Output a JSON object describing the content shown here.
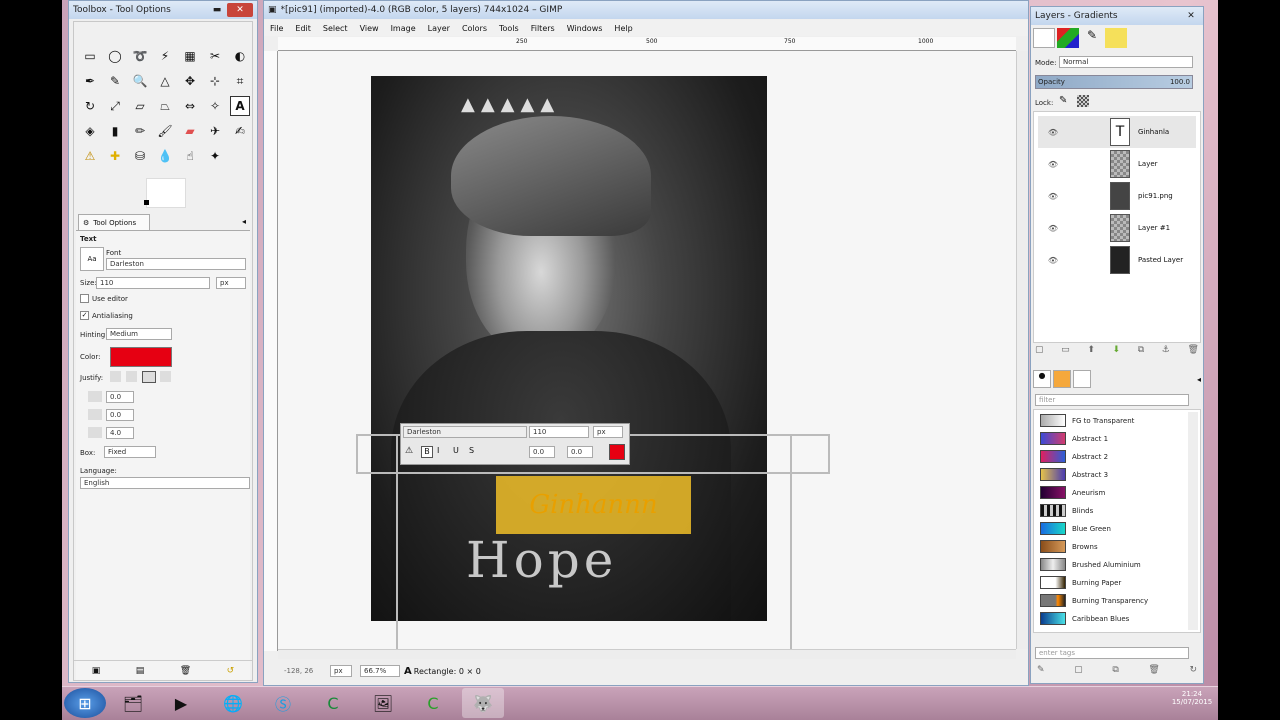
{
  "toolbox": {
    "title": "Toolbox - Tool Options",
    "tool_options_tab": "Tool Options",
    "section": "Text",
    "font_label": "Font",
    "font_value": "Darleston",
    "size_label": "Size:",
    "size_value": "110",
    "size_unit": "px",
    "use_editor": "Use editor",
    "antialiasing": "Antialiasing",
    "hinting_label": "Hinting:",
    "hinting_value": "Medium",
    "color_label": "Color:",
    "color_value": "#e60012",
    "justify_label": "Justify:",
    "indent_value": "0.0",
    "line_spacing_value": "0.0",
    "letter_spacing_value": "4.0",
    "box_label": "Box:",
    "box_value": "Fixed",
    "language_label": "Language:",
    "language_value": "English"
  },
  "image_window": {
    "title": "*[pic91] (imported)-4.0 (RGB color, 5 layers) 744x1024 – GIMP",
    "menu": [
      "File",
      "Edit",
      "Select",
      "View",
      "Image",
      "Layer",
      "Colors",
      "Tools",
      "Filters",
      "Windows",
      "Help"
    ],
    "ruler_labels": [
      "250",
      "500",
      "750",
      "1000"
    ],
    "text_toolbar": {
      "font": "Darleston",
      "size": "110",
      "unit": "px",
      "baseline": "0.0",
      "kerning": "0.0"
    },
    "status": {
      "coords": "-128, 26",
      "unit": "px",
      "zoom": "66.7%",
      "message": "Rectangle: 0 × 0"
    },
    "canvas_text": "Ginhannn"
  },
  "layers": {
    "title": "Layers - Gradients",
    "mode_label": "Mode:",
    "mode_value": "Normal",
    "opacity_label": "Opacity",
    "opacity_value": "100.0",
    "lock_label": "Lock:",
    "items": [
      {
        "name": "Ginhanla",
        "type": "text"
      },
      {
        "name": "Layer"
      },
      {
        "name": "pic91.png"
      },
      {
        "name": "Layer #1"
      },
      {
        "name": "Pasted Layer"
      }
    ],
    "filter_placeholder": "filter",
    "tag_placeholder": "enter tags",
    "gradients": [
      {
        "name": "FG to Transparent",
        "colors": [
          "#aaaaaa",
          "#ffffff"
        ]
      },
      {
        "name": "Abstract 1",
        "colors": [
          "#3a4bd6",
          "#d33b6d"
        ]
      },
      {
        "name": "Abstract 2",
        "colors": [
          "#e0205f",
          "#2c5fd8"
        ]
      },
      {
        "name": "Abstract 3",
        "colors": [
          "#e5c34a",
          "#4a3bb0"
        ]
      },
      {
        "name": "Aneurism",
        "colors": [
          "#220033",
          "#881166"
        ]
      },
      {
        "name": "Blinds",
        "colors": [
          "#111111",
          "#cccccc"
        ]
      },
      {
        "name": "Blue Green",
        "colors": [
          "#1a6be0",
          "#1ad8c8"
        ]
      },
      {
        "name": "Browns",
        "colors": [
          "#8a4d1a",
          "#d69a5a"
        ]
      },
      {
        "name": "Brushed Aluminium",
        "colors": [
          "#888888",
          "#eeeeee"
        ]
      },
      {
        "name": "Burning Paper",
        "colors": [
          "#ffffff",
          "#332200"
        ]
      },
      {
        "name": "Burning Transparency",
        "colors": [
          "#ff8800",
          "#222222"
        ]
      },
      {
        "name": "Caribbean Blues",
        "colors": [
          "#0a3d8f",
          "#4ae0e6"
        ]
      }
    ]
  },
  "taskbar": {
    "time": "21:24",
    "date": "15/07/2015"
  }
}
